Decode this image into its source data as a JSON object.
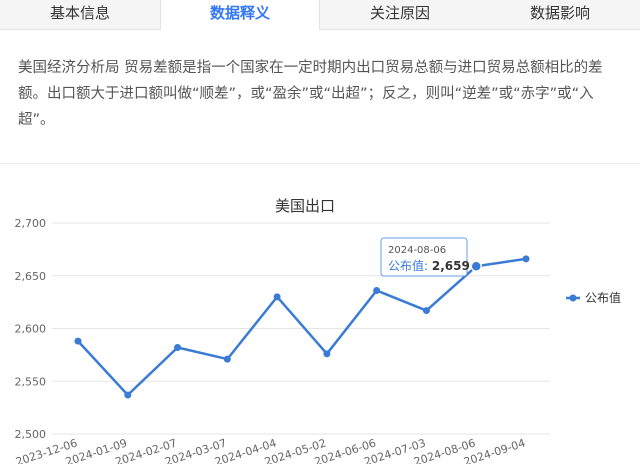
{
  "tabs": [
    {
      "label": "基本信息",
      "active": false
    },
    {
      "label": "数据释义",
      "active": true
    },
    {
      "label": "关注原因",
      "active": false
    },
    {
      "label": "数据影响",
      "active": false
    }
  ],
  "description": "美国经济分析局 贸易差额是指一个国家在一定时期内出口贸易总额与进口贸易总额相比的差额。出口额大于进口额叫做“顺差”，或“盈余”或“出超”；反之，则叫“逆差”或“赤字”或“入超”。",
  "colors": {
    "accent": "#3478f6",
    "line": "#3a7bd5"
  },
  "tooltip": {
    "date": "2024-08-06",
    "label": "公布值:",
    "value": "2,659"
  },
  "chart_data": {
    "type": "line",
    "title": "美国出口",
    "x": [
      "2023-12-06",
      "2024-01-09",
      "2024-02-07",
      "2024-03-07",
      "2024-04-04",
      "2024-05-02",
      "2024-06-06",
      "2024-07-03",
      "2024-08-06",
      "2024-09-04"
    ],
    "series": [
      {
        "name": "公布值",
        "values": [
          2588,
          2537,
          2582,
          2571,
          2630,
          2576,
          2636,
          2617,
          2659,
          2666
        ]
      }
    ],
    "ylim": [
      2500,
      2700
    ],
    "yticks": [
      2500,
      2550,
      2600,
      2650,
      2700
    ],
    "ytick_labels": [
      "2,500",
      "2,550",
      "2,600",
      "2,650",
      "2,700"
    ],
    "grid": true,
    "legend": "right"
  }
}
